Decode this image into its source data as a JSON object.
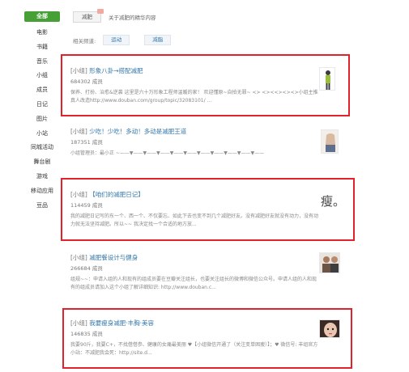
{
  "sidebar": {
    "items": [
      {
        "label": "全部",
        "active": true
      },
      {
        "label": "电影"
      },
      {
        "label": "书籍"
      },
      {
        "label": "音乐"
      },
      {
        "label": "小组"
      },
      {
        "label": "成员"
      },
      {
        "label": "日记"
      },
      {
        "label": "图片"
      },
      {
        "label": "小站"
      },
      {
        "label": "同城活动"
      },
      {
        "label": "舞台剧"
      },
      {
        "label": "游戏"
      },
      {
        "label": "移动应用"
      },
      {
        "label": "豆品"
      }
    ]
  },
  "search": {
    "query": "减肥",
    "hint": "关于减肥的精华内容"
  },
  "related": {
    "label": "相关频道:",
    "tags": [
      "运动",
      "减脂"
    ]
  },
  "results": [
    {
      "type": "[小组]",
      "title": "形象八卦→搭配减肥",
      "members": "684302 成员",
      "desc": "保养、打扮、治愈&逆袭 这里是六十万形象工程师温暖的家！ 欢迎懂原~自拍无罪~ <> <><<><><>小组主推 真人改造http://www.douban.com/group/topic/32083101/ ..."
    },
    {
      "type": "[小组]",
      "title": "少吃！少吃！多动！多动是减肥王道",
      "members": "187351 成员",
      "desc": "小组管理员：最小正 ~——▼——▼——▼——▼——▼——▼——▼——▼——▼——▼——"
    },
    {
      "type": "[小组]",
      "title": "【咱们的减肥日记】",
      "members": "114459 成员",
      "desc": "我的减肥日记写的东一个、西一个、不仅要忘、如此下去也变不到几个减肥好友。没有减肥好友就没有动力，没有动力就无法坚持减肥。所以~~ 我决定找一个合适的地方放...",
      "thumb_text": "瘦。"
    },
    {
      "type": "[小组]",
      "title": "减肥餐设计与健身",
      "members": "266684 成员",
      "desc": "组规~~：申请入组的人和现有的组成员要在豆瓣关注组长，也要关注组长的微博和微信公众号。申请人组的人和现有的组成员请加入这个小组了解详细知识: http://www.douban.c..."
    },
    {
      "type": "[小组]",
      "title": "我要瘦身减肥·丰胸·美容",
      "members": "146835 成员",
      "desc": "我要90斤，我要C+，不找借借参、健康的女痛最美丽 ♥【小组微信开通了（关注变单困瘦）】；♥ 微信号: 丰组官方小站：不减肥我会死：http://site.d..."
    }
  ],
  "colors": {
    "accent_green": "#47a036",
    "link_blue": "#3377aa",
    "highlight_red": "#e2222a"
  }
}
